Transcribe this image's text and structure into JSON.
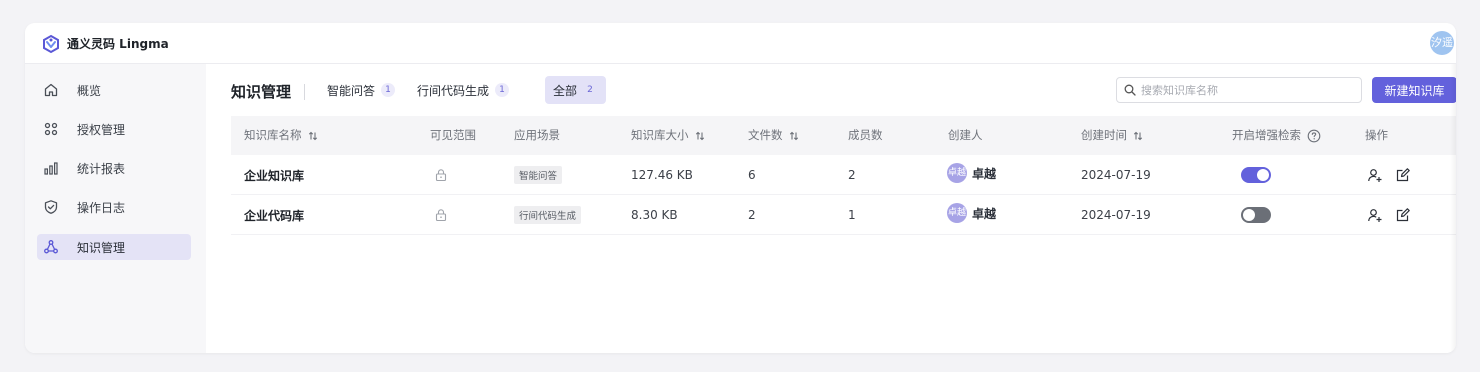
{
  "app": {
    "title": "通义灵码 Lingma",
    "user_avatar_text": "汐遥",
    "brand_color": "#6361dc"
  },
  "sidebar": {
    "items": [
      {
        "label": "概览",
        "icon": "home-icon",
        "active": false
      },
      {
        "label": "授权管理",
        "icon": "grid-icon",
        "active": false
      },
      {
        "label": "统计报表",
        "icon": "bar-chart-icon",
        "active": false
      },
      {
        "label": "操作日志",
        "icon": "shield-icon",
        "active": false
      },
      {
        "label": "知识管理",
        "icon": "network-icon",
        "active": true
      }
    ]
  },
  "main": {
    "page_title": "知识管理",
    "tabs": [
      {
        "label": "智能问答",
        "count": "1",
        "active": false
      },
      {
        "label": "行间代码生成",
        "count": "1",
        "active": false
      },
      {
        "label": "全部",
        "count": "2",
        "active": true
      }
    ],
    "search": {
      "placeholder": "搜索知识库名称",
      "value": ""
    },
    "new_button": "新建知识库"
  },
  "table": {
    "columns": [
      "知识库名称",
      "可见范围",
      "应用场景",
      "知识库大小",
      "文件数",
      "成员数",
      "创建人",
      "创建时间",
      "开启增强检索",
      "操作"
    ],
    "rows": [
      {
        "name": "企业知识库",
        "visibility": "lock-icon",
        "scene": "智能问答",
        "size": "127.46 KB",
        "files": "6",
        "members": "2",
        "creator_avatar": "卓越",
        "creator": "卓越",
        "created": "2024-07-19",
        "enhanced": true
      },
      {
        "name": "企业代码库",
        "visibility": "lock-icon",
        "scene": "行间代码生成",
        "size": "8.30 KB",
        "files": "2",
        "members": "1",
        "creator_avatar": "卓越",
        "creator": "卓越",
        "created": "2024-07-19",
        "enhanced": false
      }
    ]
  }
}
